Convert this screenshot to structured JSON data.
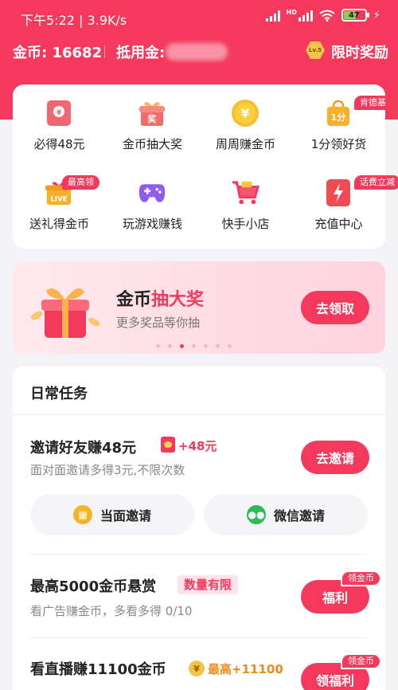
{
  "status_bar": {
    "time_speed": "下午5:22 | 3.9K/s",
    "battery": "47"
  },
  "account": {
    "coins": "金币: 16682",
    "voucher_label": "抵用金:",
    "level": "Lv.5",
    "limit_reward": "限时奖励"
  },
  "entries": [
    {
      "label": "必得48元",
      "icon": "red-envelope-icon"
    },
    {
      "label": "金币抽大奖",
      "icon": "gift-box-icon"
    },
    {
      "label": "周周赚金币",
      "icon": "yuan-coin-icon"
    },
    {
      "label": "1分领好货",
      "icon": "shopping-bag-icon",
      "tag": "肯德基"
    },
    {
      "label": "送礼得金币",
      "icon": "live-gift-icon",
      "tag": "最高领"
    },
    {
      "label": "玩游戏赚钱",
      "icon": "gamepad-icon"
    },
    {
      "label": "快手小店",
      "icon": "shopping-cart-icon"
    },
    {
      "label": "充值中心",
      "icon": "lightning-icon",
      "tag": "话费立减"
    }
  ],
  "banner": {
    "title_a": "金币",
    "title_b": "抽大奖",
    "subtitle": "更多奖品等你抽",
    "button": "去领取",
    "slide_count": 7,
    "active_slide": 3
  },
  "tasks": {
    "heading": "日常任务",
    "invite": {
      "title": "邀请好友赚48元",
      "reward": "+48元",
      "subtitle": "面对面邀请多得3元,不限次数",
      "button": "去邀请",
      "face_invite": "当面邀请",
      "wechat_invite": "微信邀请"
    },
    "bounty": {
      "title": "最高5000金币悬赏",
      "badge": "数量有限",
      "subtitle": "看广告赚金币，多看多得 0/10",
      "corner_tag": "领金币",
      "button": "福利"
    },
    "live": {
      "title": "看直播赚11100金币",
      "reward": "最高+11100",
      "corner_tag": "领金币",
      "button": "领福利"
    }
  },
  "colors": {
    "brand": "#f4395c",
    "gold": "#f3c44a",
    "wechat": "#2dbb55"
  }
}
